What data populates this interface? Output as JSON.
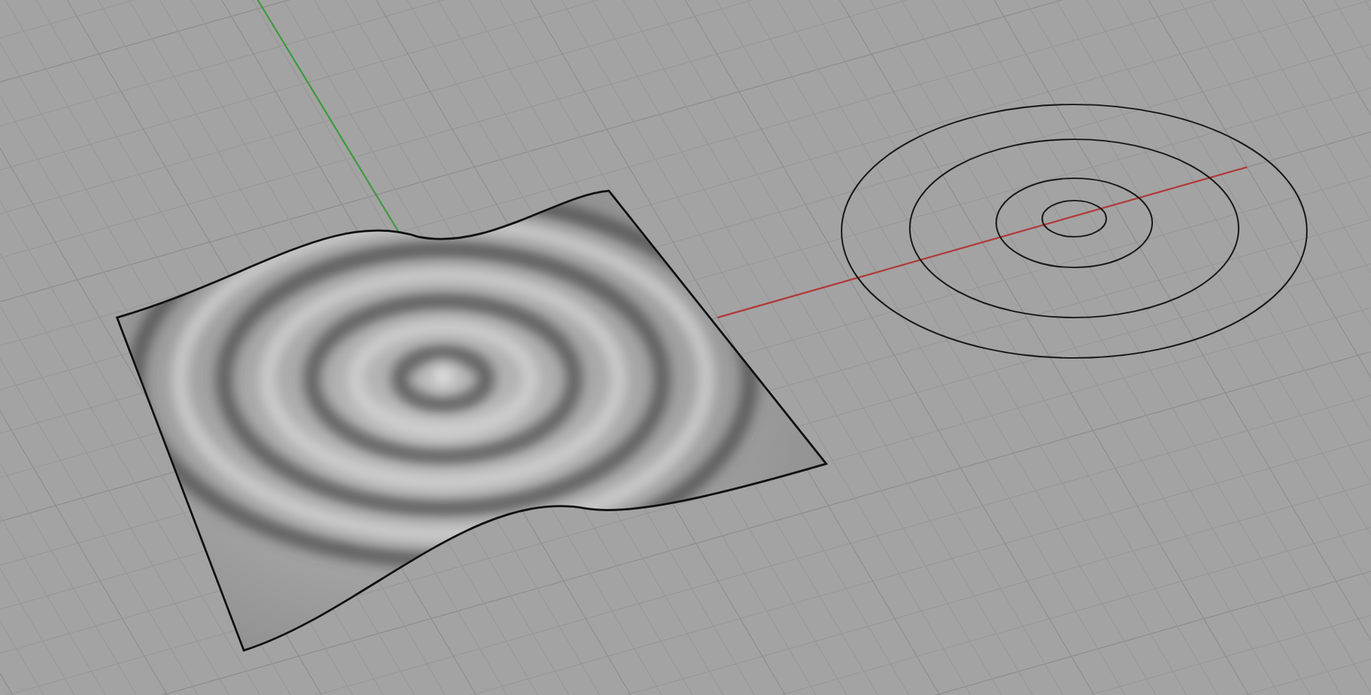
{
  "axes": [
    {
      "kind": "x",
      "color": "#b23a3a"
    },
    {
      "kind": "y",
      "color": "#3f9a3f"
    }
  ]
}
